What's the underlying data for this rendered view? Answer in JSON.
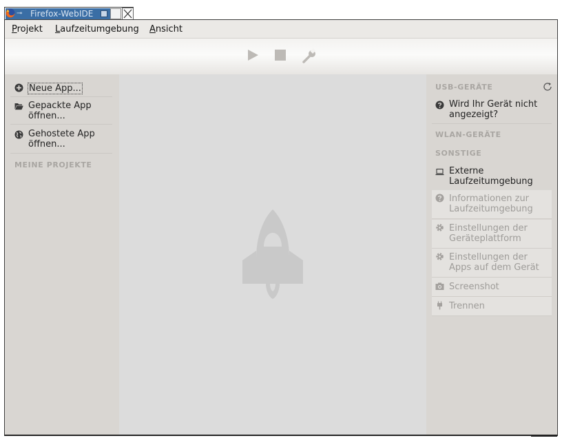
{
  "window": {
    "title": "Firefox-WebIDE",
    "pin_glyph": "⊸",
    "icon": "firefox-icon"
  },
  "menubar": {
    "items": [
      {
        "label": "Projekt",
        "mnemonic": "P",
        "rest": "rojekt"
      },
      {
        "label": "Laufzeitumgebung",
        "mnemonic": "L",
        "rest": "aufzeitumgebung"
      },
      {
        "label": "Ansicht",
        "mnemonic": "A",
        "rest": "nsicht"
      }
    ]
  },
  "toolbar": {
    "buttons": [
      {
        "name": "play-icon"
      },
      {
        "name": "stop-icon"
      },
      {
        "name": "wrench-icon"
      }
    ]
  },
  "sidebar": {
    "items": [
      {
        "label": "Neue App...",
        "icon": "plus-circle-icon"
      },
      {
        "label": "Gepackte App\nöffnen...",
        "line1": "Gepackte App",
        "line2": "öffnen...",
        "icon": "folder-icon"
      },
      {
        "label": "Gehostete App\nöffnen...",
        "line1": "Gehostete App",
        "line2": "öffnen...",
        "icon": "globe-icon"
      }
    ],
    "projects_heading": "MEINE PROJEKTE"
  },
  "center": {
    "logo": "rocket-icon"
  },
  "rightpanel": {
    "usb_heading": "USB-GERÄTE",
    "refresh_icon": "refresh-icon",
    "usb_help": {
      "line1": "Wird Ihr Gerät nicht",
      "line2": "angezeigt?",
      "icon": "help-icon"
    },
    "wlan_heading": "WLAN-GERÄTE",
    "other_heading": "SONSTIGE",
    "external_runtime": {
      "line1": "Externe",
      "line2": "Laufzeitumgebung",
      "icon": "laptop-icon"
    },
    "actions": [
      {
        "line1": "Informationen zur",
        "line2": "Laufzeitumgebung",
        "icon": "help-icon"
      },
      {
        "line1": "Einstellungen der",
        "line2": "Geräteplattform",
        "icon": "gear-icon"
      },
      {
        "line1": "Einstellungen der",
        "line2": "Apps auf dem Gerät",
        "icon": "gear-icon"
      },
      {
        "line1": "Screenshot",
        "icon": "camera-icon"
      },
      {
        "line1": "Trennen",
        "icon": "plug-icon"
      }
    ]
  },
  "colors": {
    "titlebar": "#3a6ea5",
    "panel": "#d9d6d2",
    "center": "#dcdcdc",
    "heading": "#a9a6a2",
    "disabled_text": "#9e9c99"
  }
}
